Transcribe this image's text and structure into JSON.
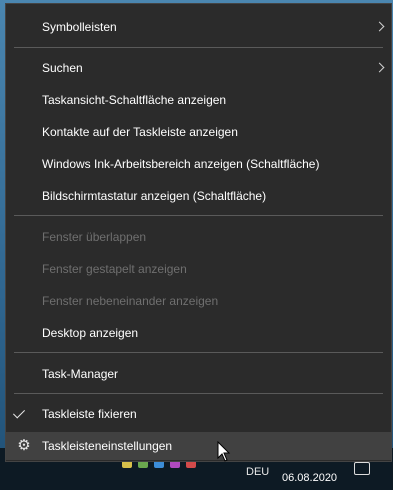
{
  "menu": {
    "items": [
      {
        "label": "Symbolleisten"
      },
      {
        "label": "Suchen"
      },
      {
        "label": "Taskansicht-Schaltfläche anzeigen"
      },
      {
        "label": "Kontakte auf der Taskleiste anzeigen"
      },
      {
        "label": "Windows Ink-Arbeitsbereich anzeigen (Schaltfläche)"
      },
      {
        "label": "Bildschirmtastatur anzeigen (Schaltfläche)"
      },
      {
        "label": "Fenster überlappen"
      },
      {
        "label": "Fenster gestapelt anzeigen"
      },
      {
        "label": "Fenster nebeneinander anzeigen"
      },
      {
        "label": "Desktop anzeigen"
      },
      {
        "label": "Task-Manager"
      },
      {
        "label": "Taskleiste fixieren"
      },
      {
        "label": "Taskleisteneinstellungen"
      }
    ]
  },
  "taskbar": {
    "language": "DEU",
    "date": "06.08.2020"
  },
  "colors": {
    "menu_bg": "#2b2b2b",
    "hover_bg": "#414141",
    "disabled_text": "#6f6f6f",
    "text": "#ffffff"
  }
}
